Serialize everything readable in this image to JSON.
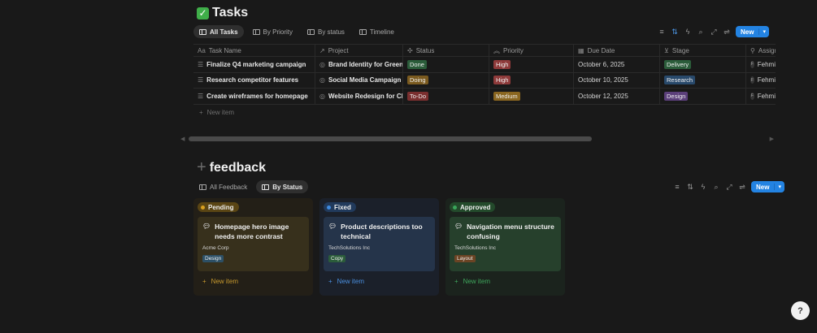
{
  "tasks": {
    "icon": "check-mark-emoji",
    "title": "Tasks",
    "views": [
      {
        "label": "All Tasks",
        "active": true
      },
      {
        "label": "By Priority",
        "active": false
      },
      {
        "label": "By status",
        "active": false
      },
      {
        "label": "Timeline",
        "active": false
      }
    ],
    "new_label": "New",
    "columns": [
      "Task Name",
      "Project",
      "Status",
      "Priority",
      "Due Date",
      "Stage",
      "Assign"
    ],
    "rows": [
      {
        "name": "Finalize Q4 marketing campaign",
        "project": "Brand Identity for GreenLe",
        "status": "Done",
        "priority": "High",
        "due": "October 6, 2025",
        "stage": "Delivery",
        "assignee_initial": "F",
        "assignee": "Fehmi"
      },
      {
        "name": "Research competitor features",
        "project": "Social Media Campaign for",
        "status": "Doing",
        "priority": "High",
        "due": "October 10, 2025",
        "stage": "Research",
        "assignee_initial": "F",
        "assignee": "Fehmi"
      },
      {
        "name": "Create wireframes for homepage",
        "project": "Website Redesign for Clou",
        "status": "To-Do",
        "priority": "Medium",
        "due": "October 12, 2025",
        "stage": "Design",
        "assignee_initial": "F",
        "assignee": "Fehmi"
      }
    ],
    "new_item": "New item"
  },
  "feedback": {
    "title": "feedback",
    "views": [
      {
        "label": "All Feedback",
        "active": false
      },
      {
        "label": "By Status",
        "active": true
      }
    ],
    "new_label": "New",
    "columns": [
      {
        "status": "Pending",
        "card_title": "Homepage hero image needs more contrast",
        "client": "Acme Corp",
        "tag": "Design",
        "new_item": "New item"
      },
      {
        "status": "Fixed",
        "card_title": "Product descriptions too technical",
        "client": "TechSolutions Inc",
        "tag": "Copy",
        "new_item": "New item"
      },
      {
        "status": "Approved",
        "card_title": "Navigation menu structure confusing",
        "client": "TechSolutions Inc",
        "tag": "Layout",
        "new_item": "New item"
      }
    ]
  },
  "help_button": "?"
}
